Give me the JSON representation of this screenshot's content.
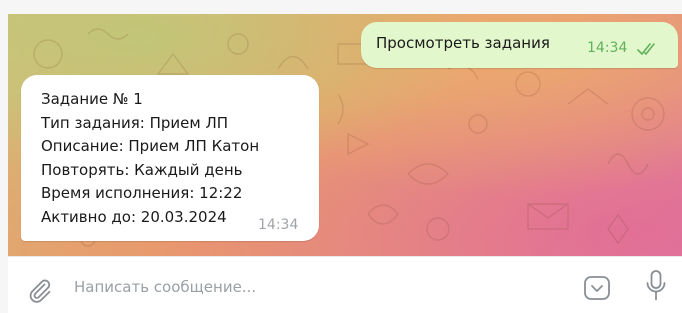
{
  "chat": {
    "outgoing": {
      "text": "Просмотреть задания",
      "time": "14:34",
      "status_icon": "double-check-icon"
    },
    "incoming": {
      "lines": [
        "Задание № 1",
        "Тип задания: Прием ЛП",
        "Описание: Прием ЛП Катон",
        "Повторять: Каждый день",
        "Время исполнения: 12:22",
        "Активно до: 20.03.2024"
      ],
      "time": "14:34"
    }
  },
  "composer": {
    "placeholder": "Написать сообщение...",
    "value": ""
  },
  "colors": {
    "outgoing_bubble": "#e3f7cc",
    "outgoing_time": "#5fb25a",
    "incoming_bubble": "#ffffff",
    "incoming_time": "#a0a4a8",
    "icon": "#8a8f94"
  }
}
